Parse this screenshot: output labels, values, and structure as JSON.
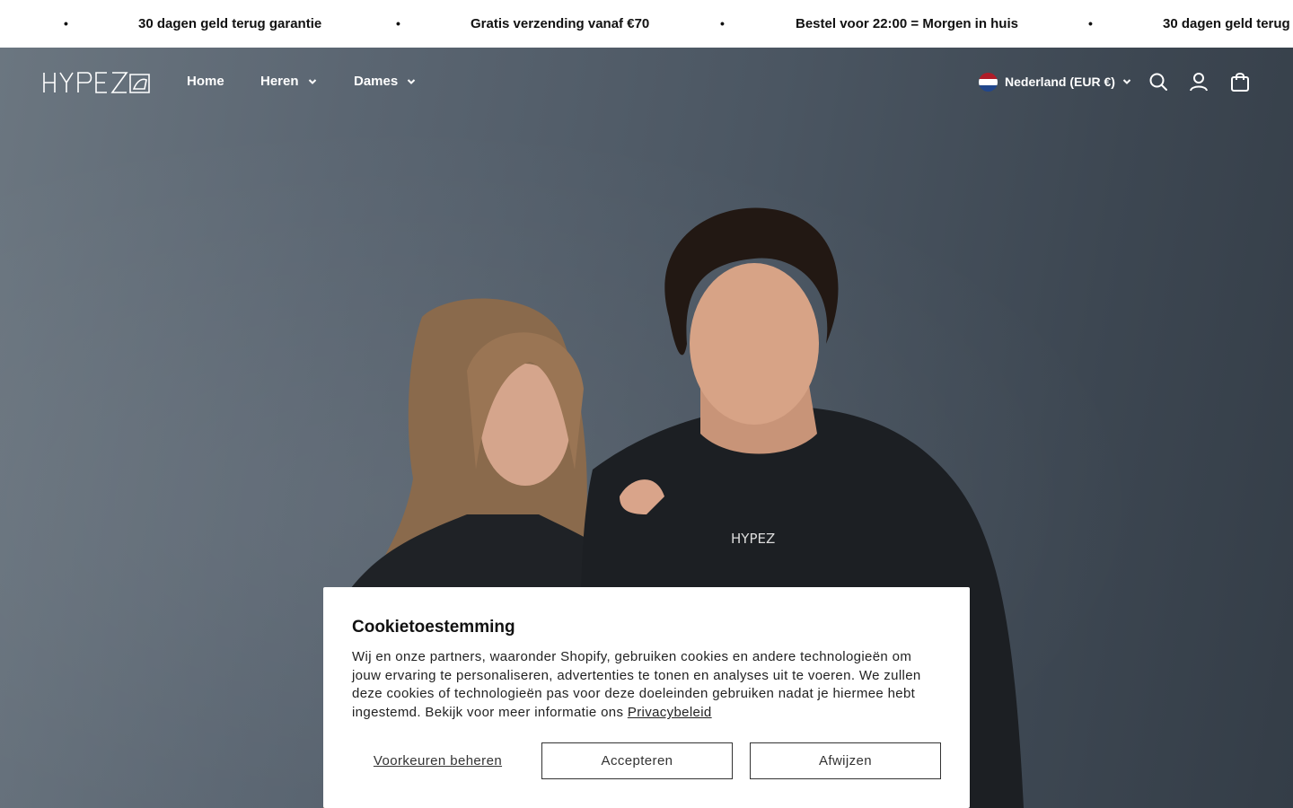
{
  "announcement": {
    "items": [
      "30 dagen geld terug garantie",
      "Gratis verzending vanaf €70",
      "Bestel voor 22:00 = Morgen in huis",
      "30 dagen geld terug"
    ],
    "separator": "•"
  },
  "header": {
    "logo_alt": "HYPEZ",
    "nav": [
      {
        "label": "Home",
        "has_dropdown": false
      },
      {
        "label": "Heren",
        "has_dropdown": true
      },
      {
        "label": "Dames",
        "has_dropdown": true
      }
    ],
    "locale": {
      "label": "Nederland (EUR €)",
      "flag": "nl-flag-icon"
    },
    "icons": [
      "search-icon",
      "account-icon",
      "cart-icon"
    ]
  },
  "hero": {
    "image_description": "Two models wearing black long sleeve HYPEZ shirts against grey backdrop",
    "shirt_logo": "HYPEZ"
  },
  "cookie_banner": {
    "title": "Cookietoestemming",
    "body": "Wij en onze partners, waaronder Shopify, gebruiken cookies en andere technologieën om jouw ervaring te personaliseren, advertenties te tonen en analyses uit te voeren. We zullen deze cookies of technologieën pas voor deze doeleinden gebruiken nadat je hiermee hebt ingestemd. Bekijk voor meer informatie ons",
    "link_label": "Privacybeleid",
    "manage_label": "Voorkeuren beheren",
    "accept_label": "Accepteren",
    "decline_label": "Afwijzen"
  },
  "colors": {
    "flag_red": "#AE1C28",
    "flag_white": "#FFFFFF",
    "flag_blue": "#21468B",
    "hero_bg": "#4b5662"
  }
}
